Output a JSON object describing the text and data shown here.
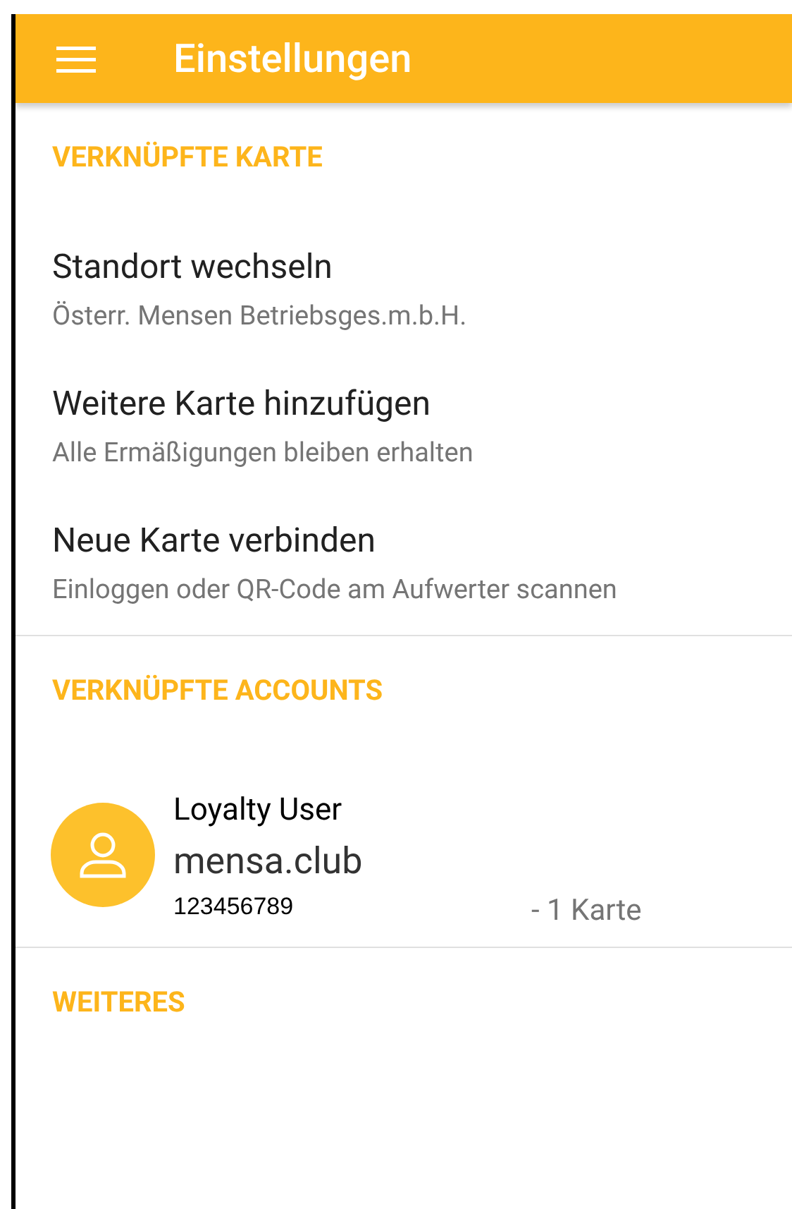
{
  "app_bar": {
    "title": "Einstellungen"
  },
  "sections": [
    {
      "header": "VERKNÜPFTE KARTE",
      "items": [
        {
          "title": "Standort wechseln",
          "subtitle": "Österr. Mensen Betriebsges.m.b.H."
        },
        {
          "title": "Weitere Karte hinzufügen",
          "subtitle": "Alle Ermäßigungen bleiben erhalten"
        },
        {
          "title": "Neue Karte verbinden",
          "subtitle": "Einloggen oder QR-Code am Aufwerter scannen"
        }
      ]
    },
    {
      "header": "VERKNÜPFTE ACCOUNTS",
      "accounts": [
        {
          "name": "Loyalty User",
          "provider": "mensa.club",
          "number": "123456789",
          "cards": "- 1 Karte"
        }
      ]
    },
    {
      "header": "WEITERES"
    }
  ]
}
